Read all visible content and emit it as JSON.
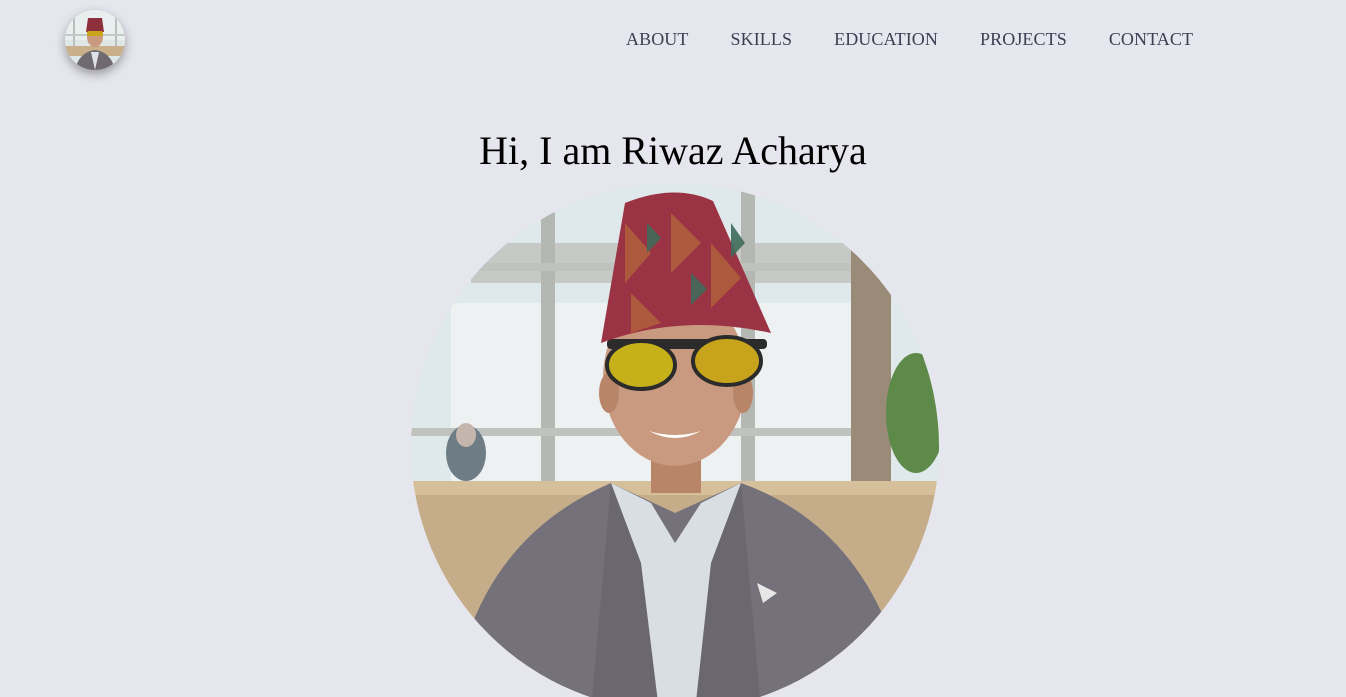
{
  "header": {
    "nav": [
      {
        "label": "ABOUT"
      },
      {
        "label": "SKILLS"
      },
      {
        "label": "EDUCATION"
      },
      {
        "label": "PROJECTS"
      },
      {
        "label": "CONTACT"
      }
    ]
  },
  "hero": {
    "title": "Hi, I am Riwaz Acharya"
  },
  "colors": {
    "background": "#e6e6ee",
    "nav_text": "#3a3f52",
    "title_text": "#000000"
  }
}
